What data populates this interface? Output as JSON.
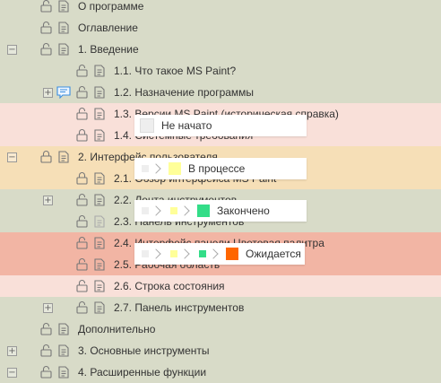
{
  "colors": {
    "row_olive": "#d8dbc8",
    "row_pink": "#f9e0d9",
    "row_orange": "#f6dfb7",
    "row_red": "#f2b5a4",
    "status_not_started": "#eeeeee",
    "status_in_progress": "#ffff99",
    "status_done": "#33dd88",
    "status_waiting": "#ff6600"
  },
  "tree": [
    {
      "label": "О программе"
    },
    {
      "label": "Оглавление"
    },
    {
      "label": "1. Введение"
    },
    {
      "label": "1.1. Что такое MS Paint?"
    },
    {
      "label": "1.2. Назначение программы"
    },
    {
      "label": "1.3. Версии MS Paint (историческая справка)"
    },
    {
      "label": "1.4. Системные требования"
    },
    {
      "label": "2. Интерфейс пользователя"
    },
    {
      "label": "2.1. Обзор интерфейса MS Paint"
    },
    {
      "label": "2.2. Лента инструментов"
    },
    {
      "label": "2.3. Панель инструментов"
    },
    {
      "label": "2.4. Интерфейс панели Цветовая палитра"
    },
    {
      "label": "2.5. Рабочая область"
    },
    {
      "label": "2.6. Строка состояния"
    },
    {
      "label": "2.7. Панель инструментов"
    },
    {
      "label": "Дополнительно"
    },
    {
      "label": "3. Основные инструменты"
    },
    {
      "label": "4. Расширенные функции"
    }
  ],
  "status_popups": [
    {
      "label": "Не начато"
    },
    {
      "label": "В процессе"
    },
    {
      "label": "Закончено"
    },
    {
      "label": "Ожидается"
    }
  ],
  "icons": {
    "lock": "lock-icon",
    "document": "document-icon",
    "comment": "comment-icon",
    "expand": "plus-icon",
    "collapse": "minus-icon"
  },
  "expander_symbols": {
    "plus": "+",
    "minus": "−"
  }
}
